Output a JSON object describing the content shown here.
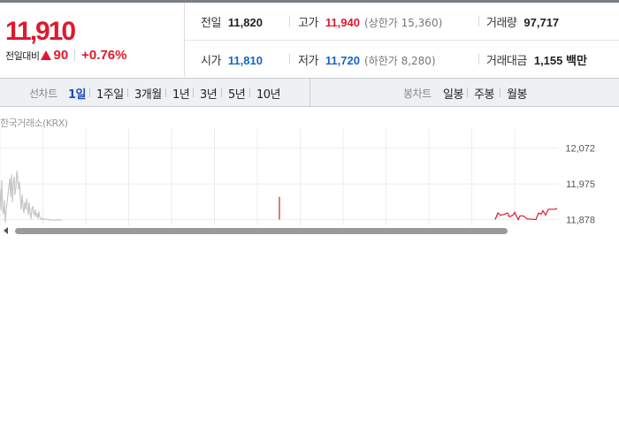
{
  "quote": {
    "price": "11,910",
    "change_label": "전일대비",
    "change_value": "90",
    "change_pct": "+0.76%",
    "direction": "up",
    "up_color": "#e0182d",
    "down_color": "#1565c0"
  },
  "stats": {
    "prev_close": {
      "label": "전일",
      "value": "11,820"
    },
    "high": {
      "label": "고가",
      "value": "11,940",
      "sub": "(상한가 15,360)"
    },
    "volume": {
      "label": "거래량",
      "value": "97,717"
    },
    "open": {
      "label": "시가",
      "value": "11,810"
    },
    "low": {
      "label": "저가",
      "value": "11,720",
      "sub": "(하한가 8,280)"
    },
    "trade_amount": {
      "label": "거래대금",
      "value": "1,155 백만"
    }
  },
  "line_chart_tabs": {
    "label": "선차트",
    "items": [
      "1일",
      "1주일",
      "3개월",
      "1년",
      "3년",
      "5년",
      "10년"
    ],
    "active": "1일"
  },
  "candle_chart_tabs": {
    "label": "봉차트",
    "items": [
      "일봉",
      "주봉",
      "월봉"
    ]
  },
  "exchange": "한국거래소(KRX)",
  "chart_data": {
    "type": "line",
    "y_tick_labels": [
      "12,072",
      "11,975",
      "11,878"
    ],
    "ylim": [
      11860,
      12100
    ],
    "grid": true,
    "series": [
      {
        "color": "#c7c7c7",
        "x": [
          0,
          1,
          2,
          3,
          4,
          5,
          6,
          7,
          8,
          9,
          10,
          11,
          12,
          13,
          14,
          15,
          16,
          17,
          18,
          19,
          20,
          21,
          22,
          23,
          24,
          25,
          26,
          27,
          28,
          29,
          30,
          31,
          32,
          33,
          34,
          35,
          36,
          37,
          38,
          39,
          40,
          41,
          42,
          43,
          44,
          45,
          46,
          47,
          48,
          49,
          50,
          52,
          55,
          58,
          62,
          66,
          70
        ],
        "y": [
          11960,
          11905,
          11985,
          11900,
          11895,
          11930,
          11870,
          11905,
          11925,
          11945,
          11965,
          11990,
          11940,
          12000,
          11925,
          11975,
          11995,
          11945,
          11965,
          12010,
          11990,
          11960,
          11980,
          11940,
          11905,
          11945,
          11915,
          11895,
          11925,
          11905,
          11935,
          11915,
          11890,
          11925,
          11900,
          11880,
          11905,
          11915,
          11895,
          11890,
          11905,
          11885,
          11895,
          11880,
          11900,
          11885,
          11880,
          11878,
          11882,
          11878,
          11880,
          11879,
          11878,
          11877,
          11876,
          11877,
          11878
        ]
      },
      {
        "color": "#e0182d",
        "x": [
          316,
          316
        ],
        "y": [
          11878,
          11940
        ]
      },
      {
        "color": "#e0182d",
        "x": [
          560,
          563,
          566,
          570,
          574,
          576,
          580,
          582,
          586,
          588,
          592,
          596,
          606,
          609,
          612,
          614,
          617,
          620,
          623,
          627,
          630
        ],
        "y": [
          11878,
          11896,
          11890,
          11892,
          11896,
          11886,
          11890,
          11898,
          11878,
          11888,
          11888,
          11880,
          11878,
          11896,
          11893,
          11902,
          11890,
          11906,
          11906,
          11906,
          11908
        ]
      }
    ]
  }
}
